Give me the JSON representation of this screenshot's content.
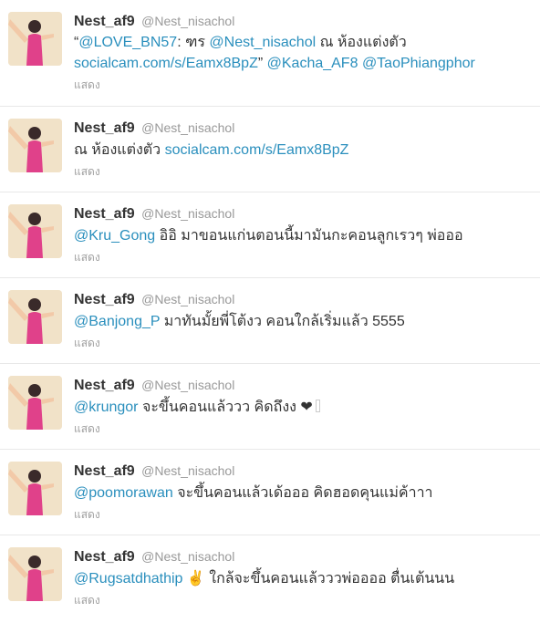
{
  "tweets": [
    {
      "name": "Nest_af9",
      "handle": "@Nest_nisachol",
      "quote_open": "“",
      "m1": "@LOVE_BN57",
      "t1": ": ฑร ",
      "m2": "@Nest_nisachol",
      "t2": " ณ ห้องแต่งตัว",
      "link": "socialcam.com/s/Eamx8BpZ",
      "quote_close": "”",
      "m3": "@Kacha_AF8",
      "m4": "@TaoPhiangphor",
      "expand": "แสดง"
    },
    {
      "name": "Nest_af9",
      "handle": "@Nest_nisachol",
      "text": "ณ ห้องแต่งตัว ",
      "link": "socialcam.com/s/Eamx8BpZ",
      "expand": "แสดง"
    },
    {
      "name": "Nest_af9",
      "handle": "@Nest_nisachol",
      "mention": "@Kru_Gong",
      "text": " อิอิ มาขอนแก่นตอนนี้มามันกะคอนลูกเรวๆ พ่อออ",
      "expand": "แสดง"
    },
    {
      "name": "Nest_af9",
      "handle": "@Nest_nisachol",
      "mention": "@Banjong_P",
      "text": " มาทันมั้ยพี่โต้งว คอนใกล้เริ่มแล้ว 5555",
      "expand": "แสดง"
    },
    {
      "name": "Nest_af9",
      "handle": "@Nest_nisachol",
      "mention": "@krungor",
      "text": " จะขึ้นคอนแล้ววว คิดถึงง ",
      "heart": "❤",
      "expand": "แสดง"
    },
    {
      "name": "Nest_af9",
      "handle": "@Nest_nisachol",
      "mention": "@poomorawan",
      "text": " จะขึ้นคอนแล้วเด้อออ คิดฮอดคุนแม่ค้าาา",
      "expand": "แสดง"
    },
    {
      "name": "Nest_af9",
      "handle": "@Nest_nisachol",
      "mention": "@Rugsatdhathip",
      "text": "  ✌ ใกล้จะขึ้นคอนแล้วววพ่ออออ ตื่นเต้นนน",
      "expand": "แสดง"
    }
  ]
}
